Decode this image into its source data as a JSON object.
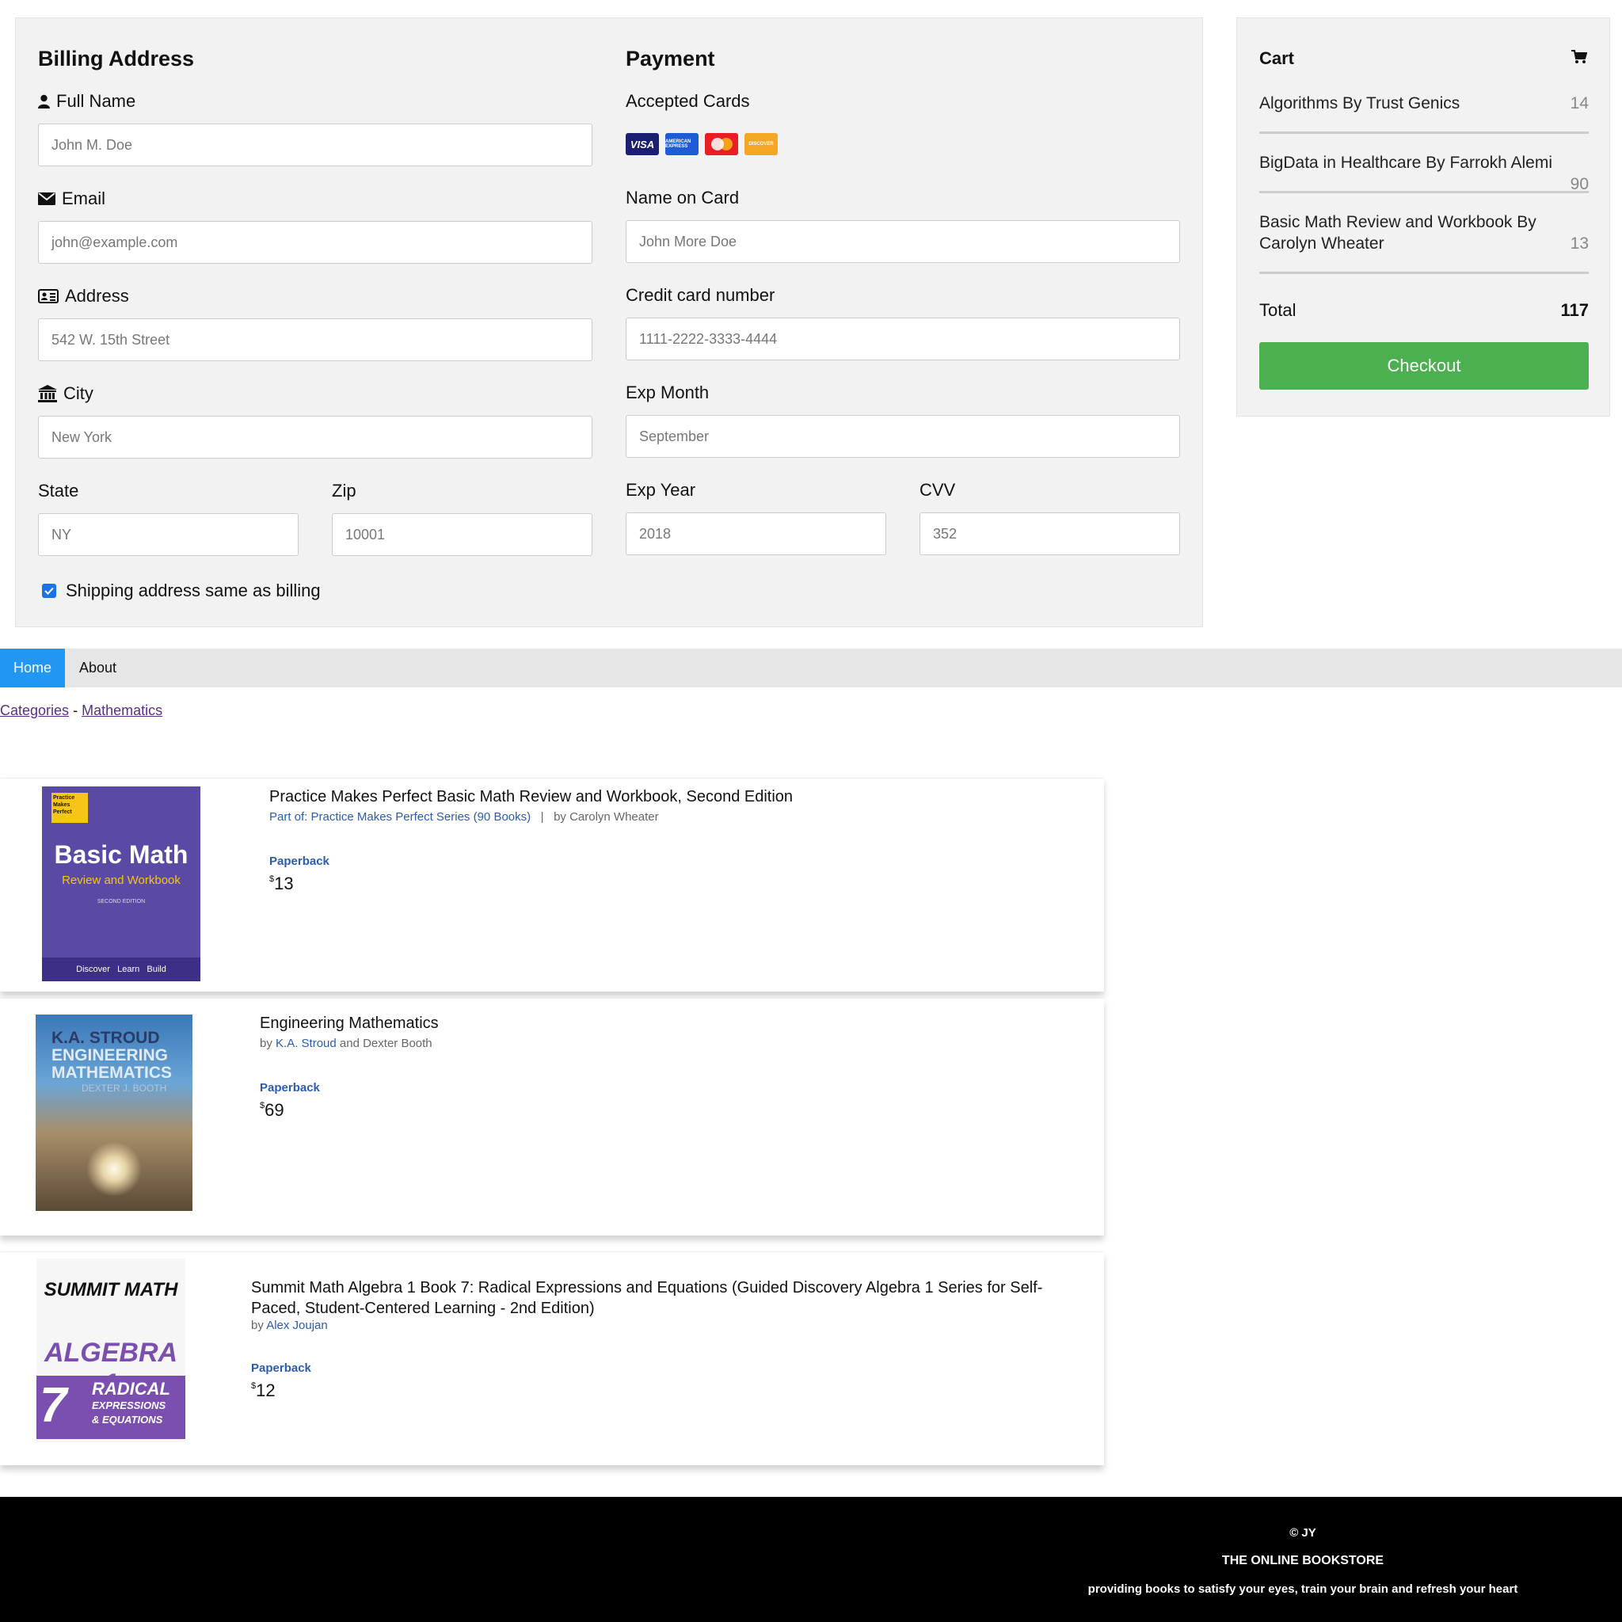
{
  "billing": {
    "title": "Billing Address",
    "full_name": {
      "label": "Full Name",
      "placeholder": "John M. Doe"
    },
    "email": {
      "label": "Email",
      "placeholder": "john@example.com"
    },
    "address": {
      "label": "Address",
      "placeholder": "542 W. 15th Street"
    },
    "city": {
      "label": "City",
      "placeholder": "New York"
    },
    "state": {
      "label": "State",
      "placeholder": "NY"
    },
    "zip": {
      "label": "Zip",
      "placeholder": "10001"
    },
    "shipping_same_label": "Shipping address same as billing",
    "shipping_same_checked": true
  },
  "payment": {
    "title": "Payment",
    "accepted_cards_label": "Accepted Cards",
    "cards": [
      "VISA",
      "AMERICAN EXPRESS",
      "MasterCard",
      "DISCOVER"
    ],
    "name_on_card": {
      "label": "Name on Card",
      "placeholder": "John More Doe"
    },
    "card_number": {
      "label": "Credit card number",
      "placeholder": "1111-2222-3333-4444"
    },
    "exp_month": {
      "label": "Exp Month",
      "placeholder": "September"
    },
    "exp_year": {
      "label": "Exp Year",
      "placeholder": "2018"
    },
    "cvv": {
      "label": "CVV",
      "placeholder": "352"
    }
  },
  "cart": {
    "title": "Cart",
    "icon": "shopping-cart-icon",
    "items": [
      {
        "name": "Algorithms By Trust Genics",
        "qty": "14"
      },
      {
        "name": "BigData in Healthcare By Farrokh Alemi",
        "qty": "90"
      },
      {
        "name": "Basic Math Review and Workbook By Carolyn Wheater",
        "qty": "13"
      }
    ],
    "total_label": "Total",
    "total_value": "117",
    "checkout_label": "Checkout",
    "checkout_color": "#4caf50"
  },
  "nav": {
    "items": [
      "Home",
      "About"
    ],
    "active": "Home",
    "active_color": "#2196f3"
  },
  "breadcrumb": {
    "items": [
      "Categories",
      "Mathematics"
    ],
    "separator": "-"
  },
  "books": [
    {
      "title": "Practice Makes Perfect Basic Math Review and Workbook, Second Edition",
      "series": "Part of: Practice Makes Perfect Series (90 Books)",
      "sep": "|",
      "by": "by",
      "author": "Carolyn Wheater",
      "format": "Paperback",
      "currency": "$",
      "price": "13",
      "cover": {
        "badge": "Practice Makes Perfect",
        "title": "Basic Math",
        "subtitle": "Review and Workbook",
        "edition": "SECOND EDITION",
        "footer": "Discover   Learn   Build"
      }
    },
    {
      "title": "Engineering Mathematics",
      "by": "by",
      "author": "K.A. Stroud",
      "coauthor": "and Dexter Booth",
      "format": "Paperback",
      "currency": "$",
      "price": "69",
      "cover": {
        "line1": "K.A. STROUD",
        "line2": "ENGINEERING",
        "line3": "MATHEMATICS",
        "line4": "DEXTER J. BOOTH"
      }
    },
    {
      "title": "Summit Math Algebra 1 Book 7: Radical Expressions and Equations (Guided Discovery Algebra 1 Series for Self-Paced, Student-Centered Learning - 2nd Edition)",
      "by": "by",
      "author": "Alex Joujan",
      "format": "Paperback",
      "currency": "$",
      "price": "12",
      "cover": {
        "brand": "SUMMIT MATH",
        "title": "ALGEBRA 1",
        "number": "7",
        "topic1": "RADICAL",
        "topic2": "EXPRESSIONS",
        "topic3": "& EQUATIONS"
      }
    }
  ],
  "footer": {
    "copyright": "© JY",
    "name": "THE ONLINE BOOKSTORE",
    "tagline": "providing books to satisfy your eyes, train your brain and refresh your heart"
  }
}
